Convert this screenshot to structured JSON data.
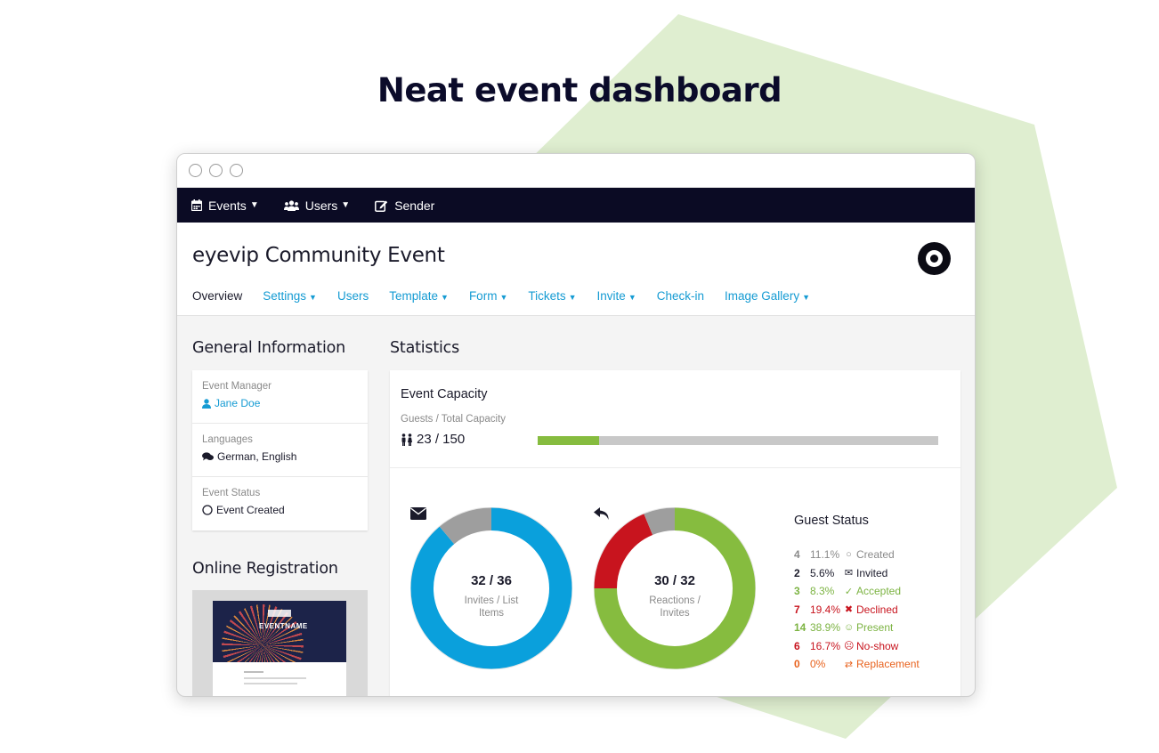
{
  "page": {
    "headline": "Neat event dashboard"
  },
  "colors": {
    "accent": "#159bd3",
    "nav_bg": "#0b0b24",
    "green": "#86bc3f",
    "red": "#c8141e",
    "gray": "#9e9e9e",
    "blue": "#0aa0dc",
    "orange": "#e8621d",
    "bg_shape": "#dfeed0"
  },
  "topnav": [
    {
      "label": "Events",
      "icon": "calendar-icon",
      "dropdown": true
    },
    {
      "label": "Users",
      "icon": "users-icon",
      "dropdown": true
    },
    {
      "label": "Sender",
      "icon": "edit-icon",
      "dropdown": false
    }
  ],
  "event": {
    "title": "eyevip Community Event",
    "logo_icon": "target-logo-icon"
  },
  "tabs": [
    {
      "label": "Overview",
      "active": true,
      "dropdown": false
    },
    {
      "label": "Settings",
      "active": false,
      "dropdown": true
    },
    {
      "label": "Users",
      "active": false,
      "dropdown": false
    },
    {
      "label": "Template",
      "active": false,
      "dropdown": true
    },
    {
      "label": "Form",
      "active": false,
      "dropdown": true
    },
    {
      "label": "Tickets",
      "active": false,
      "dropdown": true
    },
    {
      "label": "Invite",
      "active": false,
      "dropdown": true
    },
    {
      "label": "Check-in",
      "active": false,
      "dropdown": false
    },
    {
      "label": "Image Gallery",
      "active": false,
      "dropdown": true
    }
  ],
  "general": {
    "heading": "General Information",
    "manager_label": "Event Manager",
    "manager_value": "Jane Doe",
    "languages_label": "Languages",
    "languages_value": "German, English",
    "status_label": "Event Status",
    "status_value": "Event Created"
  },
  "registration": {
    "heading": "Online Registration",
    "preview_title": "EVENTNAME"
  },
  "statistics": {
    "heading": "Statistics",
    "capacity_title": "Event Capacity",
    "capacity_label": "Guests / Total Capacity",
    "capacity_value": "23 / 150",
    "capacity_guests": 23,
    "capacity_total": 150,
    "invites": {
      "value": "32 / 36",
      "caption": "Invites / List Items",
      "icon": "envelope-icon",
      "segments": [
        {
          "name": "invited",
          "value": 32,
          "color": "#0aa0dc"
        },
        {
          "name": "rest",
          "value": 4,
          "color": "#9e9e9e"
        }
      ]
    },
    "reactions": {
      "value": "30 / 32",
      "caption": "Reactions / Invites",
      "icon": "reply-icon",
      "segments": [
        {
          "name": "accepted",
          "value": 24,
          "color": "#86bc3f"
        },
        {
          "name": "declined",
          "value": 6,
          "color": "#c8141e"
        },
        {
          "name": "none",
          "value": 2,
          "color": "#9e9e9e"
        }
      ]
    }
  },
  "guest_status": {
    "title": "Guest Status",
    "rows": [
      {
        "count": "4",
        "pct": "11.1%",
        "label": "Created",
        "icon": "circle-outline-icon",
        "color": "#8a8a8a",
        "glyph": "○"
      },
      {
        "count": "2",
        "pct": "5.6%",
        "label": "Invited",
        "icon": "envelope-icon",
        "color": "#1a1a2a",
        "glyph": "✉"
      },
      {
        "count": "3",
        "pct": "8.3%",
        "label": "Accepted",
        "icon": "check-icon",
        "color": "#7cb342",
        "glyph": "✓"
      },
      {
        "count": "7",
        "pct": "19.4%",
        "label": "Declined",
        "icon": "x-icon",
        "color": "#c8141e",
        "glyph": "✖"
      },
      {
        "count": "14",
        "pct": "38.9%",
        "label": "Present",
        "icon": "smile-icon",
        "color": "#7cb342",
        "glyph": "☺"
      },
      {
        "count": "6",
        "pct": "16.7%",
        "label": "No-show",
        "icon": "frown-icon",
        "color": "#c8141e",
        "glyph": "☹"
      },
      {
        "count": "0",
        "pct": "0%",
        "label": "Replacement",
        "icon": "exchange-icon",
        "color": "#e8621d",
        "glyph": "⇄"
      }
    ]
  }
}
